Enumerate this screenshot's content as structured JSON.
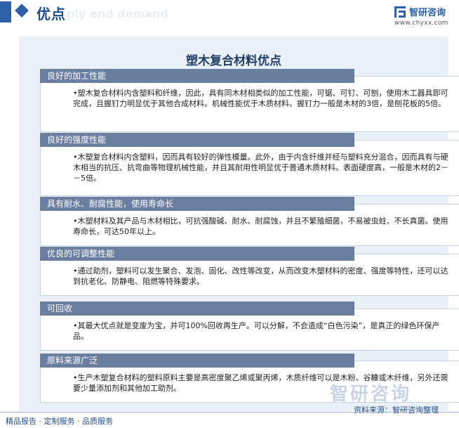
{
  "header": {
    "title": "优点",
    "watermark": "ply and demand",
    "logo_text": "智研咨询",
    "logo_url": "www.chyxx.com"
  },
  "panel": {
    "title": "塑木复合材料优点"
  },
  "cards": [
    {
      "heading": "良好的加工性能",
      "text": "•塑木复合材料内含塑料和纤维，因此，具有同木材相类似的加工性能，可锯、可钉、可刨，使用木工器具即可完成，且握钉力明显优于其他合成材料。机械性能优于木质材料。握钉力一般是木材的3倍，是刨花板的5倍。"
    },
    {
      "heading": "良好的强度性能",
      "text": "•木塑复合材料内含塑料，因而具有较好的弹性模量。此外，由于内含纤维并经与塑料充分混合，因而具有与硬木相当的抗压、抗弯曲等物理机械性能，并且其耐用性明显优于普通木质材料。表面硬度高，一般是木材的2－－5倍。"
    },
    {
      "heading": "具有耐水、耐腐性能，使用寿命长",
      "text": "•木塑材料及其产品与木材相比，可抗强酸碱、耐水、耐腐蚀，并且不繁殖细菌，不易被虫蛀、不长真菌。使用寿命长，可达50年以上。"
    },
    {
      "heading": "优良的可调整性能",
      "text": "•通过助剂，塑料可以发生聚合、发泡、固化、改性等改变，从而改变木塑材料的密度、强度等特性，还可以达到抗老化、防静电、阻燃等特殊要求。"
    },
    {
      "heading": "可回收",
      "text": "•其最大优点就是变废为宝，并可100%回收再生产。可以分解，不会造成“白色污染”，是真正的绿色环保产品。"
    },
    {
      "heading": "原料来源广泛",
      "text": "•生产木塑复合材料的塑料原料主要是高密度聚乙烯或聚丙烯，木质纤维可以是木粉、谷糠或木纤维，另外还需要少量添加剂和其他加工助剂。"
    }
  ],
  "footer": {
    "left": "精品报告 · 定制服务 · 品质服务",
    "source": "资料来源：智研咨询整理",
    "watermark": "智研咨询"
  }
}
